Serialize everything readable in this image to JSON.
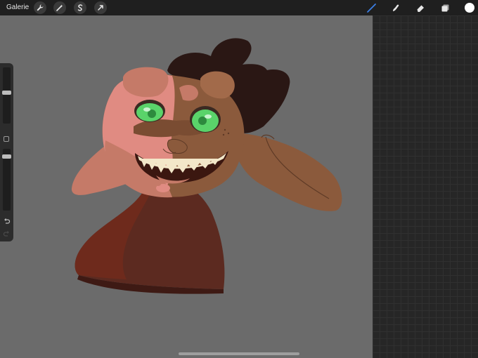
{
  "topbar": {
    "gallery_label": "Galerie",
    "left_tools": [
      "wrench-icon",
      "magic-wand-icon",
      "selection-icon",
      "transform-arrow-icon"
    ],
    "right_tools": [
      "brush-icon",
      "smudge-icon",
      "eraser-icon",
      "layers-icon"
    ],
    "active_tool": "brush-icon",
    "active_tool_color": "#3b7ee6",
    "current_color": "#ffffff"
  },
  "sidebar": {
    "brush_size_level": 0.55,
    "opacity_level": 0.9,
    "icons": [
      "modifier-square-icon",
      "undo-icon",
      "redo-icon"
    ]
  },
  "canvas": {
    "background": "#6b6b6b",
    "artwork_colors": {
      "skin": "#8b5a3c",
      "skin_light": "#c57a68",
      "highlight_pink": "#e08b82",
      "hair": "#2a1714",
      "shirt": "#5c2a20",
      "shirt_dark": "#6e2a1c",
      "eye": "#5ad36a",
      "teeth": "#f3e7c9",
      "mouth": "#3b1710"
    }
  },
  "layers_panel": {
    "background": "#262626"
  }
}
